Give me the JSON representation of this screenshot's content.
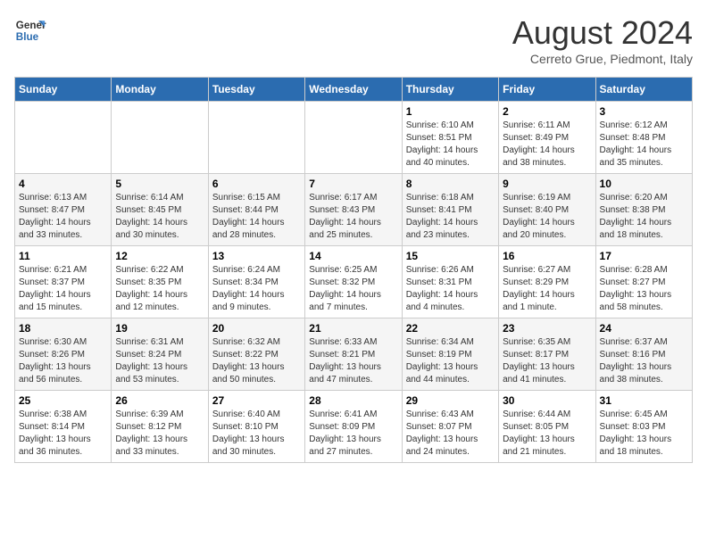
{
  "header": {
    "logo_line1": "General",
    "logo_line2": "Blue",
    "month_year": "August 2024",
    "location": "Cerreto Grue, Piedmont, Italy"
  },
  "days_of_week": [
    "Sunday",
    "Monday",
    "Tuesday",
    "Wednesday",
    "Thursday",
    "Friday",
    "Saturday"
  ],
  "weeks": [
    [
      {
        "day": "",
        "info": ""
      },
      {
        "day": "",
        "info": ""
      },
      {
        "day": "",
        "info": ""
      },
      {
        "day": "",
        "info": ""
      },
      {
        "day": "1",
        "info": "Sunrise: 6:10 AM\nSunset: 8:51 PM\nDaylight: 14 hours and 40 minutes."
      },
      {
        "day": "2",
        "info": "Sunrise: 6:11 AM\nSunset: 8:49 PM\nDaylight: 14 hours and 38 minutes."
      },
      {
        "day": "3",
        "info": "Sunrise: 6:12 AM\nSunset: 8:48 PM\nDaylight: 14 hours and 35 minutes."
      }
    ],
    [
      {
        "day": "4",
        "info": "Sunrise: 6:13 AM\nSunset: 8:47 PM\nDaylight: 14 hours and 33 minutes."
      },
      {
        "day": "5",
        "info": "Sunrise: 6:14 AM\nSunset: 8:45 PM\nDaylight: 14 hours and 30 minutes."
      },
      {
        "day": "6",
        "info": "Sunrise: 6:15 AM\nSunset: 8:44 PM\nDaylight: 14 hours and 28 minutes."
      },
      {
        "day": "7",
        "info": "Sunrise: 6:17 AM\nSunset: 8:43 PM\nDaylight: 14 hours and 25 minutes."
      },
      {
        "day": "8",
        "info": "Sunrise: 6:18 AM\nSunset: 8:41 PM\nDaylight: 14 hours and 23 minutes."
      },
      {
        "day": "9",
        "info": "Sunrise: 6:19 AM\nSunset: 8:40 PM\nDaylight: 14 hours and 20 minutes."
      },
      {
        "day": "10",
        "info": "Sunrise: 6:20 AM\nSunset: 8:38 PM\nDaylight: 14 hours and 18 minutes."
      }
    ],
    [
      {
        "day": "11",
        "info": "Sunrise: 6:21 AM\nSunset: 8:37 PM\nDaylight: 14 hours and 15 minutes."
      },
      {
        "day": "12",
        "info": "Sunrise: 6:22 AM\nSunset: 8:35 PM\nDaylight: 14 hours and 12 minutes."
      },
      {
        "day": "13",
        "info": "Sunrise: 6:24 AM\nSunset: 8:34 PM\nDaylight: 14 hours and 9 minutes."
      },
      {
        "day": "14",
        "info": "Sunrise: 6:25 AM\nSunset: 8:32 PM\nDaylight: 14 hours and 7 minutes."
      },
      {
        "day": "15",
        "info": "Sunrise: 6:26 AM\nSunset: 8:31 PM\nDaylight: 14 hours and 4 minutes."
      },
      {
        "day": "16",
        "info": "Sunrise: 6:27 AM\nSunset: 8:29 PM\nDaylight: 14 hours and 1 minute."
      },
      {
        "day": "17",
        "info": "Sunrise: 6:28 AM\nSunset: 8:27 PM\nDaylight: 13 hours and 58 minutes."
      }
    ],
    [
      {
        "day": "18",
        "info": "Sunrise: 6:30 AM\nSunset: 8:26 PM\nDaylight: 13 hours and 56 minutes."
      },
      {
        "day": "19",
        "info": "Sunrise: 6:31 AM\nSunset: 8:24 PM\nDaylight: 13 hours and 53 minutes."
      },
      {
        "day": "20",
        "info": "Sunrise: 6:32 AM\nSunset: 8:22 PM\nDaylight: 13 hours and 50 minutes."
      },
      {
        "day": "21",
        "info": "Sunrise: 6:33 AM\nSunset: 8:21 PM\nDaylight: 13 hours and 47 minutes."
      },
      {
        "day": "22",
        "info": "Sunrise: 6:34 AM\nSunset: 8:19 PM\nDaylight: 13 hours and 44 minutes."
      },
      {
        "day": "23",
        "info": "Sunrise: 6:35 AM\nSunset: 8:17 PM\nDaylight: 13 hours and 41 minutes."
      },
      {
        "day": "24",
        "info": "Sunrise: 6:37 AM\nSunset: 8:16 PM\nDaylight: 13 hours and 38 minutes."
      }
    ],
    [
      {
        "day": "25",
        "info": "Sunrise: 6:38 AM\nSunset: 8:14 PM\nDaylight: 13 hours and 36 minutes."
      },
      {
        "day": "26",
        "info": "Sunrise: 6:39 AM\nSunset: 8:12 PM\nDaylight: 13 hours and 33 minutes."
      },
      {
        "day": "27",
        "info": "Sunrise: 6:40 AM\nSunset: 8:10 PM\nDaylight: 13 hours and 30 minutes."
      },
      {
        "day": "28",
        "info": "Sunrise: 6:41 AM\nSunset: 8:09 PM\nDaylight: 13 hours and 27 minutes."
      },
      {
        "day": "29",
        "info": "Sunrise: 6:43 AM\nSunset: 8:07 PM\nDaylight: 13 hours and 24 minutes."
      },
      {
        "day": "30",
        "info": "Sunrise: 6:44 AM\nSunset: 8:05 PM\nDaylight: 13 hours and 21 minutes."
      },
      {
        "day": "31",
        "info": "Sunrise: 6:45 AM\nSunset: 8:03 PM\nDaylight: 13 hours and 18 minutes."
      }
    ]
  ]
}
